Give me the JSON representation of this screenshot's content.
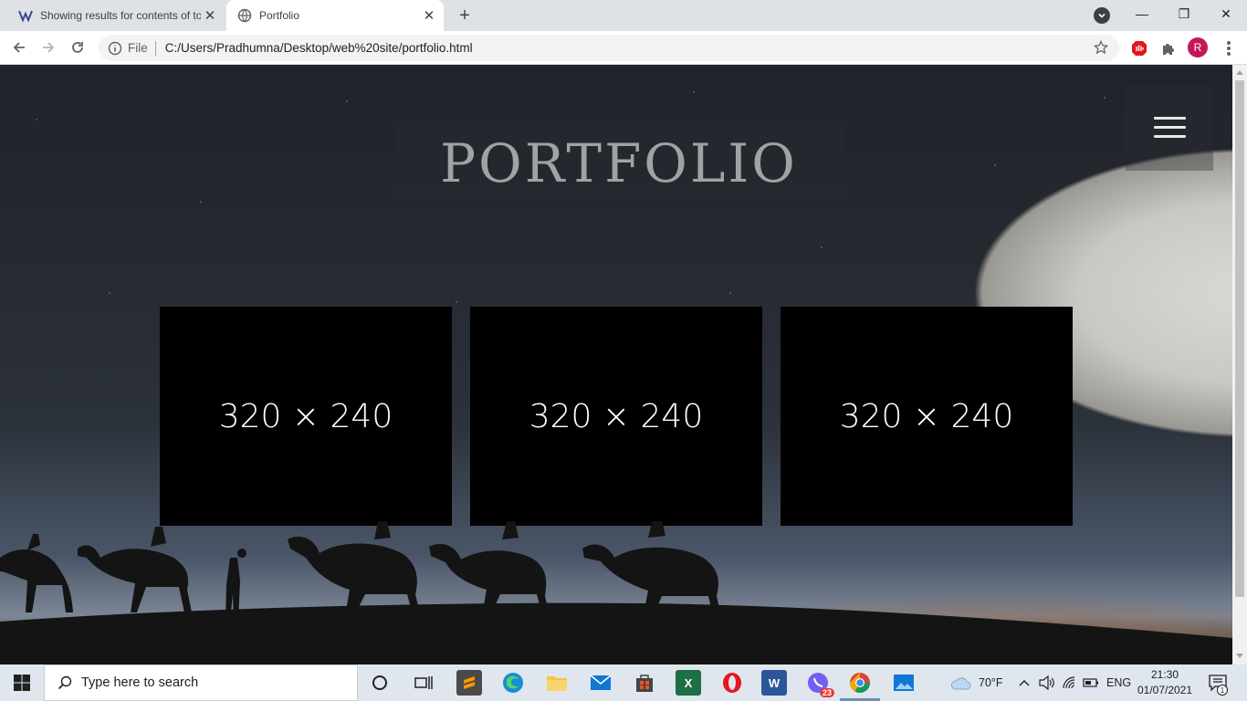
{
  "browser": {
    "tabs": [
      {
        "title": "Showing results for contents of to",
        "active": false
      },
      {
        "title": "Portfolio",
        "active": true
      }
    ],
    "new_tab_symbol": "+",
    "window_controls": {
      "minimize": "—",
      "restore": "❐",
      "close": "✕"
    },
    "address": {
      "scheme_label": "File",
      "url": "C:/Users/Pradhumna/Desktop/web%20site/portfolio.html"
    },
    "profile_initial": "R"
  },
  "page": {
    "title": "PORTFOLIO",
    "cards": [
      {
        "label": "320 × 240"
      },
      {
        "label": "320 × 240"
      },
      {
        "label": "320 × 240"
      }
    ]
  },
  "taskbar": {
    "search_placeholder": "Type here to search",
    "weather": "70°F",
    "language": "ENG",
    "time": "21:30",
    "date": "01/07/2021",
    "viber_badge": "23",
    "notifications_count": "1"
  },
  "colors": {
    "accent_profile": "#c2185b",
    "tabstrip": "#dee1e6",
    "taskbar": "#dfe6ee"
  }
}
